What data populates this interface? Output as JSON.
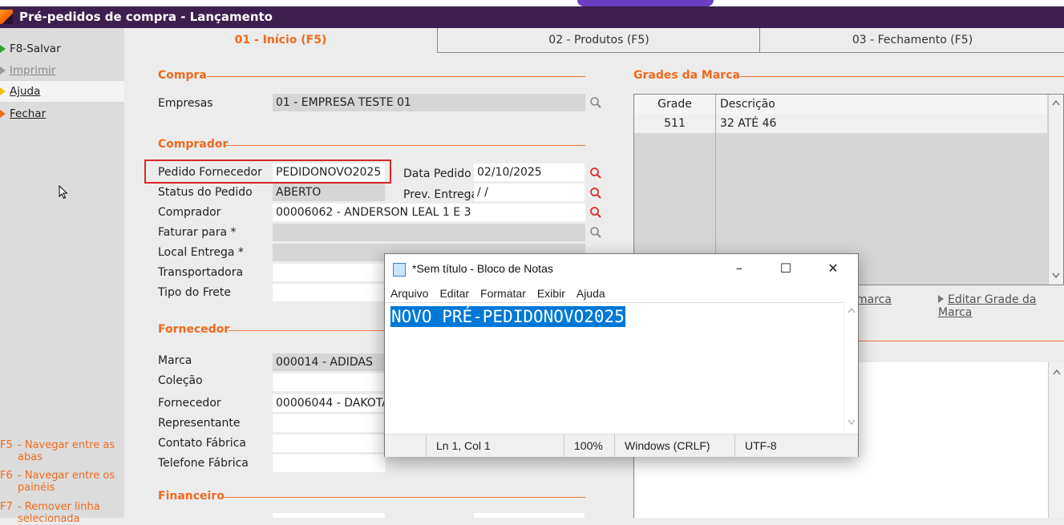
{
  "window": {
    "title": "Pré-pedidos de compra - Lançamento"
  },
  "sidebar": {
    "items": [
      {
        "label": "F8-Salvar"
      },
      {
        "label": "Imprimir"
      },
      {
        "label": "Ajuda"
      },
      {
        "label": "Fechar"
      }
    ],
    "hints": [
      {
        "key": "F5",
        "text": "- Navegar entre as abas"
      },
      {
        "key": "F6",
        "text": "- Navegar entre os painéis"
      },
      {
        "key": "F7",
        "text": "- Remover linha selecionada"
      }
    ]
  },
  "tabs": [
    {
      "label": "01 - Início (F5)"
    },
    {
      "label": "02 - Produtos (F5)"
    },
    {
      "label": "03 - Fechamento (F5)"
    }
  ],
  "form": {
    "compra": {
      "title": "Compra",
      "empresas_label": "Empresas",
      "empresas_value": "01 - EMPRESA TESTE  01"
    },
    "comprador": {
      "title": "Comprador",
      "pedido_fornecedor_label": "Pedido Fornecedor",
      "pedido_fornecedor_value": "PEDIDONOVO2025",
      "data_pedido_label": "Data Pedido",
      "data_pedido_value": "02/10/2025",
      "status_label": "Status do Pedido",
      "status_value": "ABERTO",
      "prev_entrega_label": "Prev. Entrega",
      "prev_entrega_value": " / /",
      "comprador_label": "Comprador",
      "comprador_value": "00006062 - ANDERSON LEAL 1 E 3",
      "faturar_label": "Faturar para *",
      "local_entrega_label": "Local Entrega *",
      "transportadora_label": "Transportadora",
      "tipo_frete_label": "Tipo do Frete"
    },
    "fornecedor": {
      "title": "Fornecedor",
      "marca_label": "Marca",
      "marca_value": "000014 - ADIDAS",
      "colecao_label": "Coleção",
      "fornecedor_label": "Fornecedor",
      "fornecedor_value": "00006044 - DAKOTA",
      "representante_label": "Representante",
      "contato_label": "Contato Fábrica",
      "telefone_label": "Telefone Fábrica"
    },
    "financeiro": {
      "title": "Financeiro"
    }
  },
  "grades": {
    "title": "Grades da Marca",
    "columns": [
      "Grade",
      "Descrição"
    ],
    "rows": [
      {
        "grade": "511",
        "descricao": "32 ATÉ 46"
      }
    ],
    "link_partial": "marca",
    "link_edit": "Editar Grade da Marca"
  },
  "notepad": {
    "title": "*Sem título - Bloco de Notas",
    "menu": [
      "Arquivo",
      "Editar",
      "Formatar",
      "Exibir",
      "Ajuda"
    ],
    "content": "NOVO PRÉ-PEDIDONOVO2025",
    "status": {
      "position": "Ln 1, Col 1",
      "zoom": "100%",
      "eol": "Windows (CRLF)",
      "encoding": "UTF-8"
    }
  },
  "colors": {
    "accent": "#f06a1c",
    "titlebar": "#3c1f4f",
    "highlight": "#d9262a",
    "selection": "#0078d7"
  }
}
